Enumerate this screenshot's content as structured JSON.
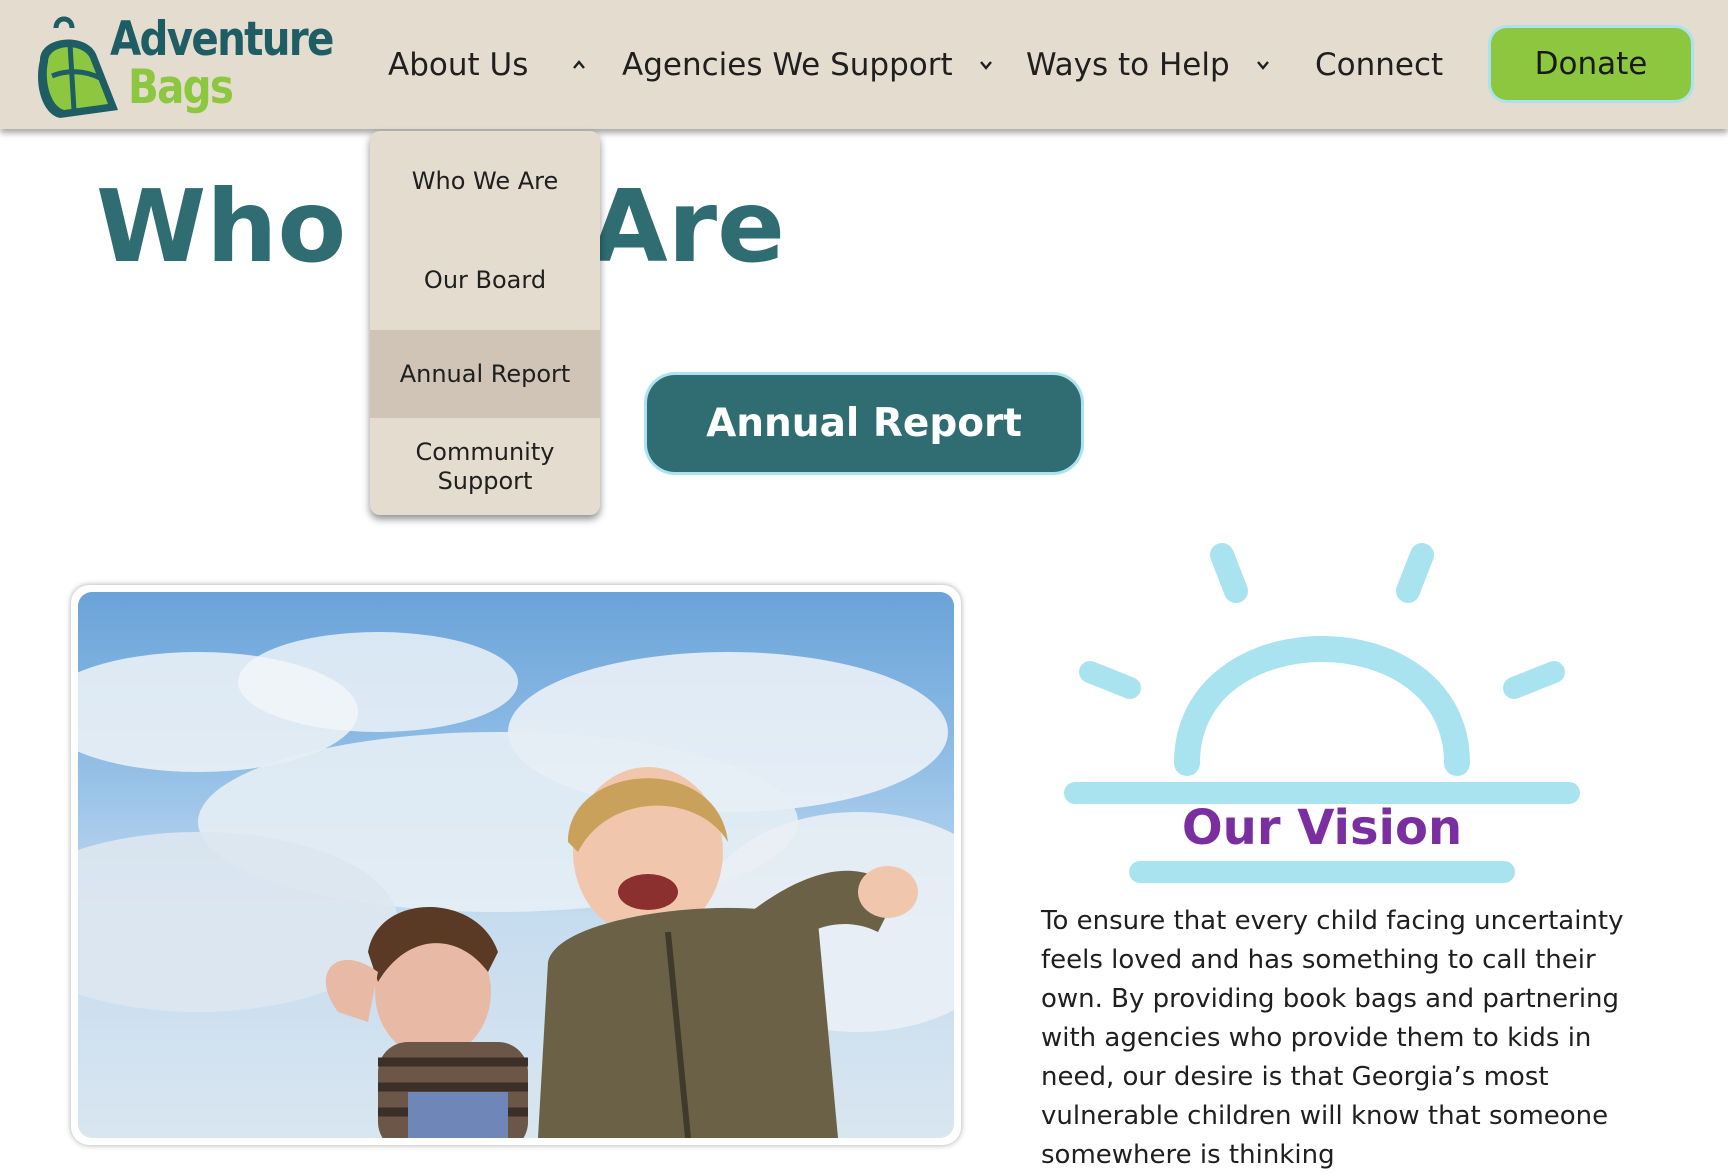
{
  "brand": {
    "name_line1": "Adventure",
    "name_line2": "Bags",
    "logo_icon": "backpack-icon",
    "colors": {
      "teal": "#1d5d63",
      "green": "#8dc63f"
    }
  },
  "nav": {
    "items": [
      {
        "label": "About Us",
        "icon": "chevron-up-icon"
      },
      {
        "label": "Agencies We Support",
        "icon": "chevron-down-icon"
      },
      {
        "label": "Ways to Help",
        "icon": "chevron-down-icon"
      },
      {
        "label": "Connect"
      }
    ],
    "donate_label": "Donate"
  },
  "dropdown": {
    "items": [
      {
        "label": "Who We Are"
      },
      {
        "label": "Our Board"
      },
      {
        "label": "Annual Report",
        "active": true
      },
      {
        "label": "Community Support"
      }
    ]
  },
  "main": {
    "title": "Who We Are",
    "annual_report_button": "Annual Report",
    "photo": {
      "icon": "children-playing-photo"
    }
  },
  "vision": {
    "icon": "sunrise-icon",
    "title": "Our Vision",
    "text": "To ensure that every child facing uncertainty feels loved and has something to call their own. By providing book bags and partnering with agencies who provide them to kids in need, our desire is that Georgia’s most vulnerable children will know that someone somewhere is thinking",
    "colors": {
      "title": "#7a2ea0",
      "sun": "#a9e3f0"
    }
  }
}
